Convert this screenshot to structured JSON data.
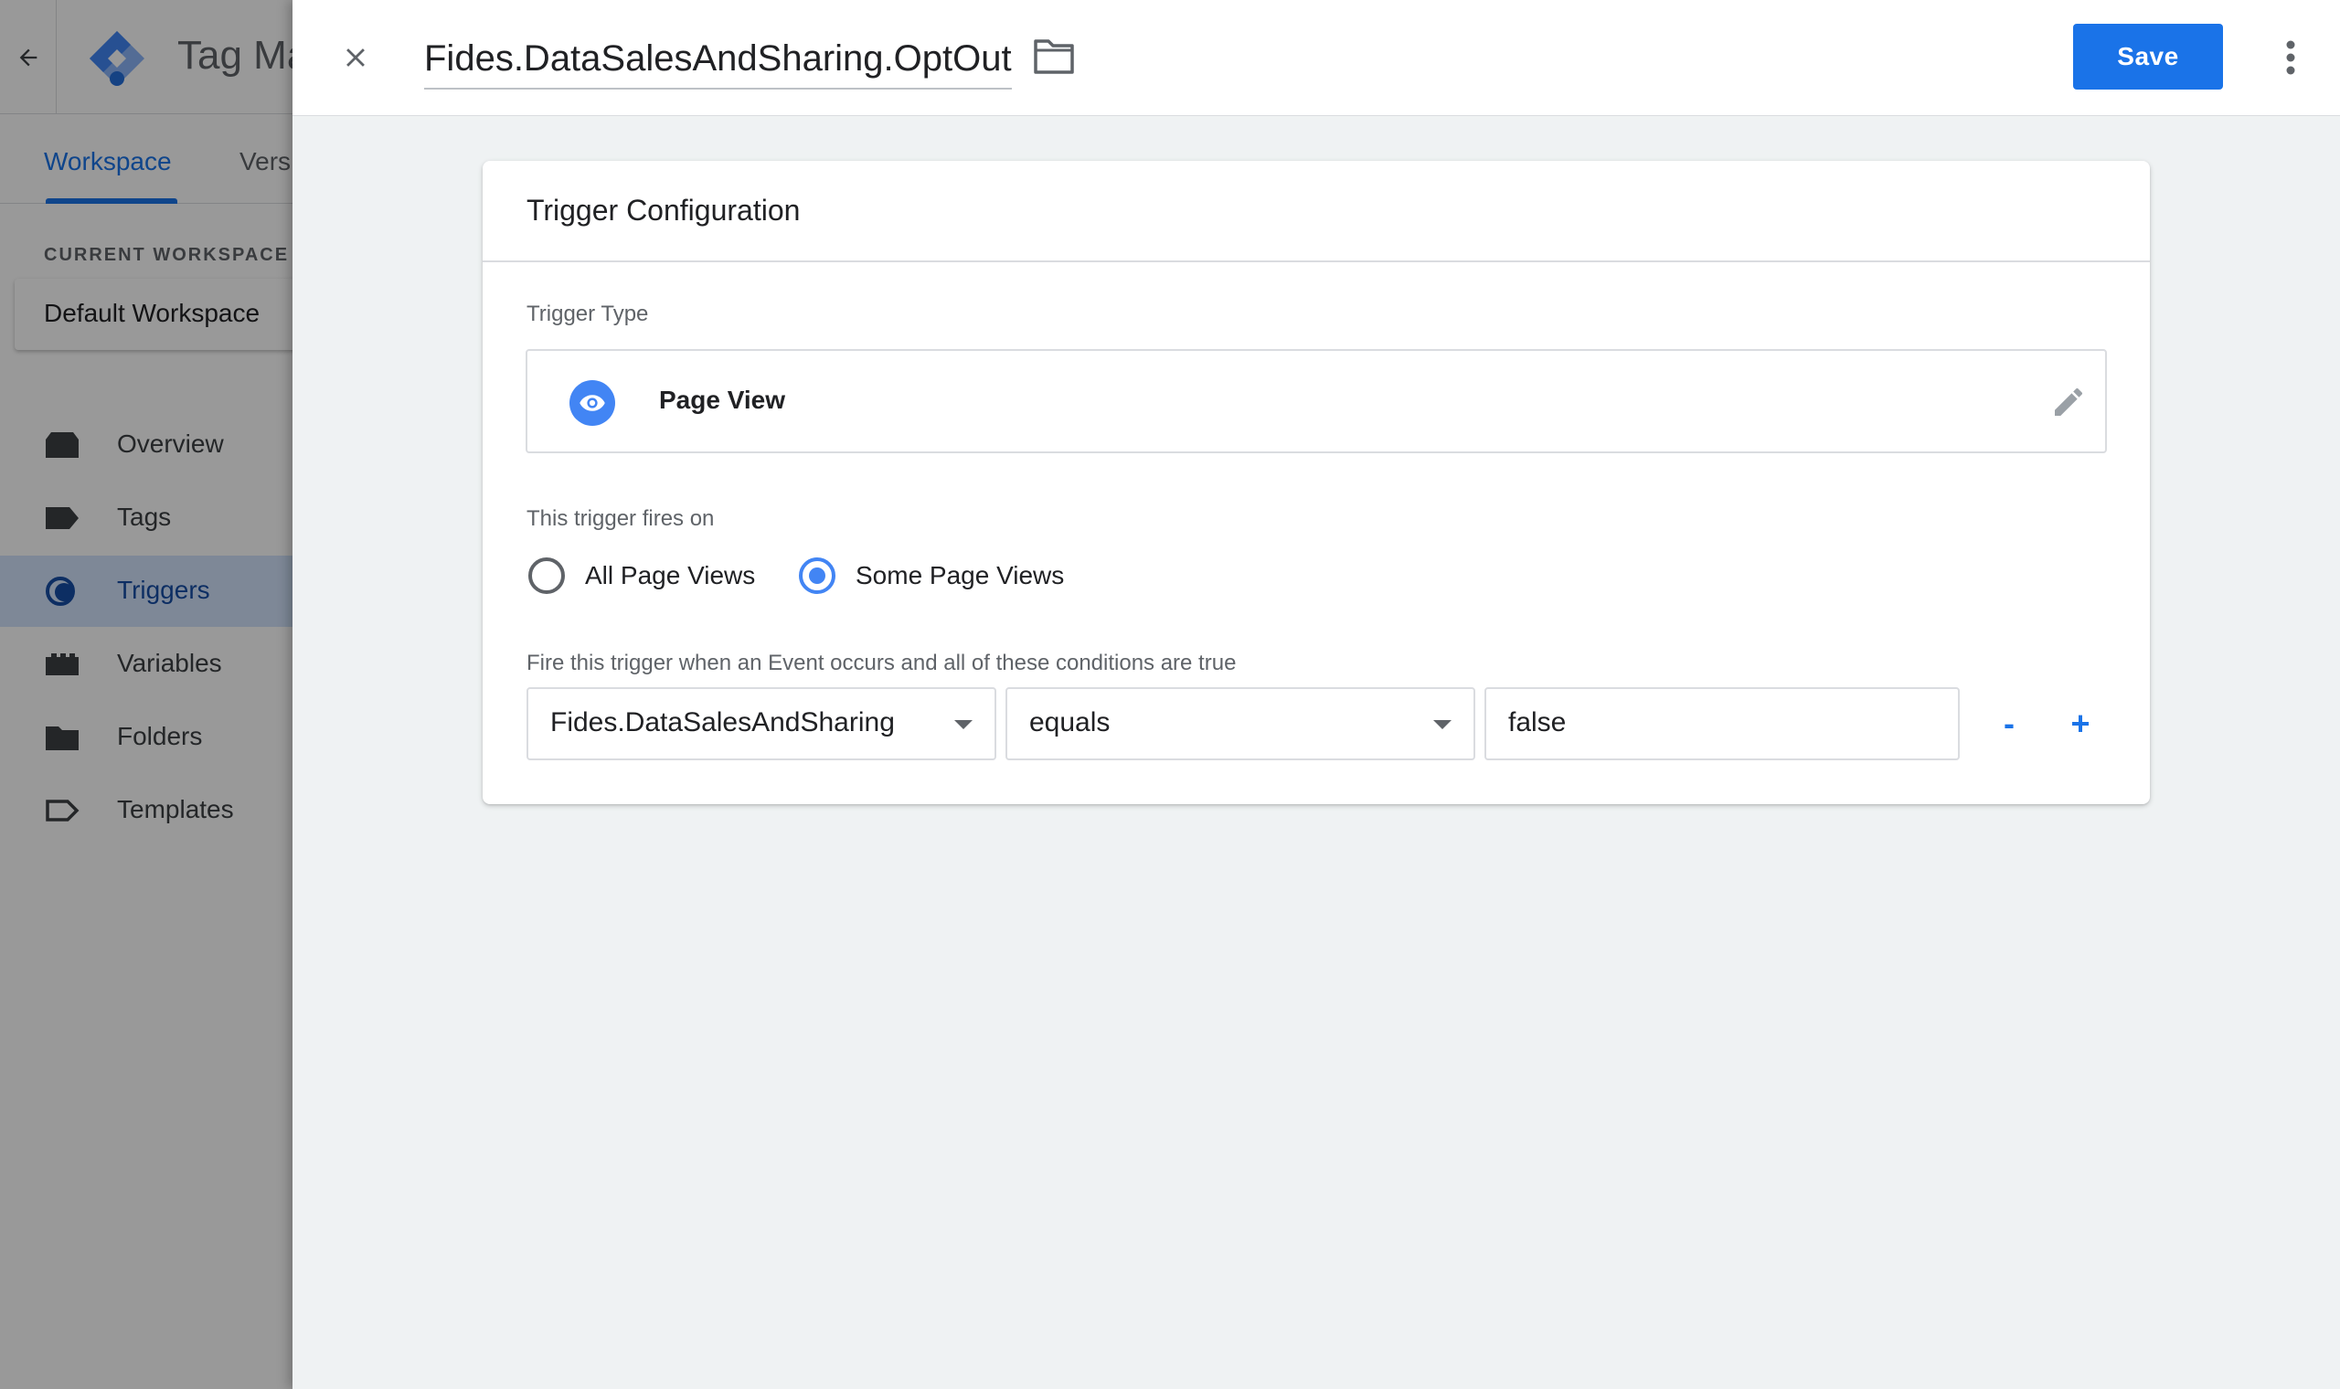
{
  "background_app": {
    "title": "Tag Ma",
    "tabs": [
      {
        "label": "Workspace",
        "active": true
      },
      {
        "label": "Vers",
        "active": false
      }
    ],
    "current_workspace_label": "CURRENT WORKSPACE",
    "current_workspace_name": "Default Workspace",
    "nav": [
      {
        "label": "Overview",
        "icon": "overview-icon",
        "active": false
      },
      {
        "label": "Tags",
        "icon": "tag-icon",
        "active": false
      },
      {
        "label": "Triggers",
        "icon": "trigger-icon",
        "active": true
      },
      {
        "label": "Variables",
        "icon": "variables-icon",
        "active": false
      },
      {
        "label": "Folders",
        "icon": "folder-icon",
        "active": false
      },
      {
        "label": "Templates",
        "icon": "template-icon",
        "active": false
      }
    ]
  },
  "header": {
    "trigger_name": "Fides.DataSalesAndSharing.OptOut",
    "save_label": "Save"
  },
  "card": {
    "title": "Trigger Configuration",
    "trigger_type_label": "Trigger Type",
    "trigger_type_name": "Page View",
    "fires_on_label": "This trigger fires on",
    "fires_on_options": [
      {
        "label": "All Page Views",
        "checked": false
      },
      {
        "label": "Some Page Views",
        "checked": true
      }
    ],
    "condition_label": "Fire this trigger when an Event occurs and all of these conditions are true",
    "condition": {
      "variable": "Fides.DataSalesAndSharing",
      "operator": "equals",
      "value": "false"
    },
    "remove_label": "-",
    "add_label": "+"
  },
  "colors": {
    "accent": "#1a73e8",
    "trigger_icon_bg": "#4285f4",
    "active_nav_bg": "#d2e3fc",
    "page_bg": "#eff2f3"
  }
}
